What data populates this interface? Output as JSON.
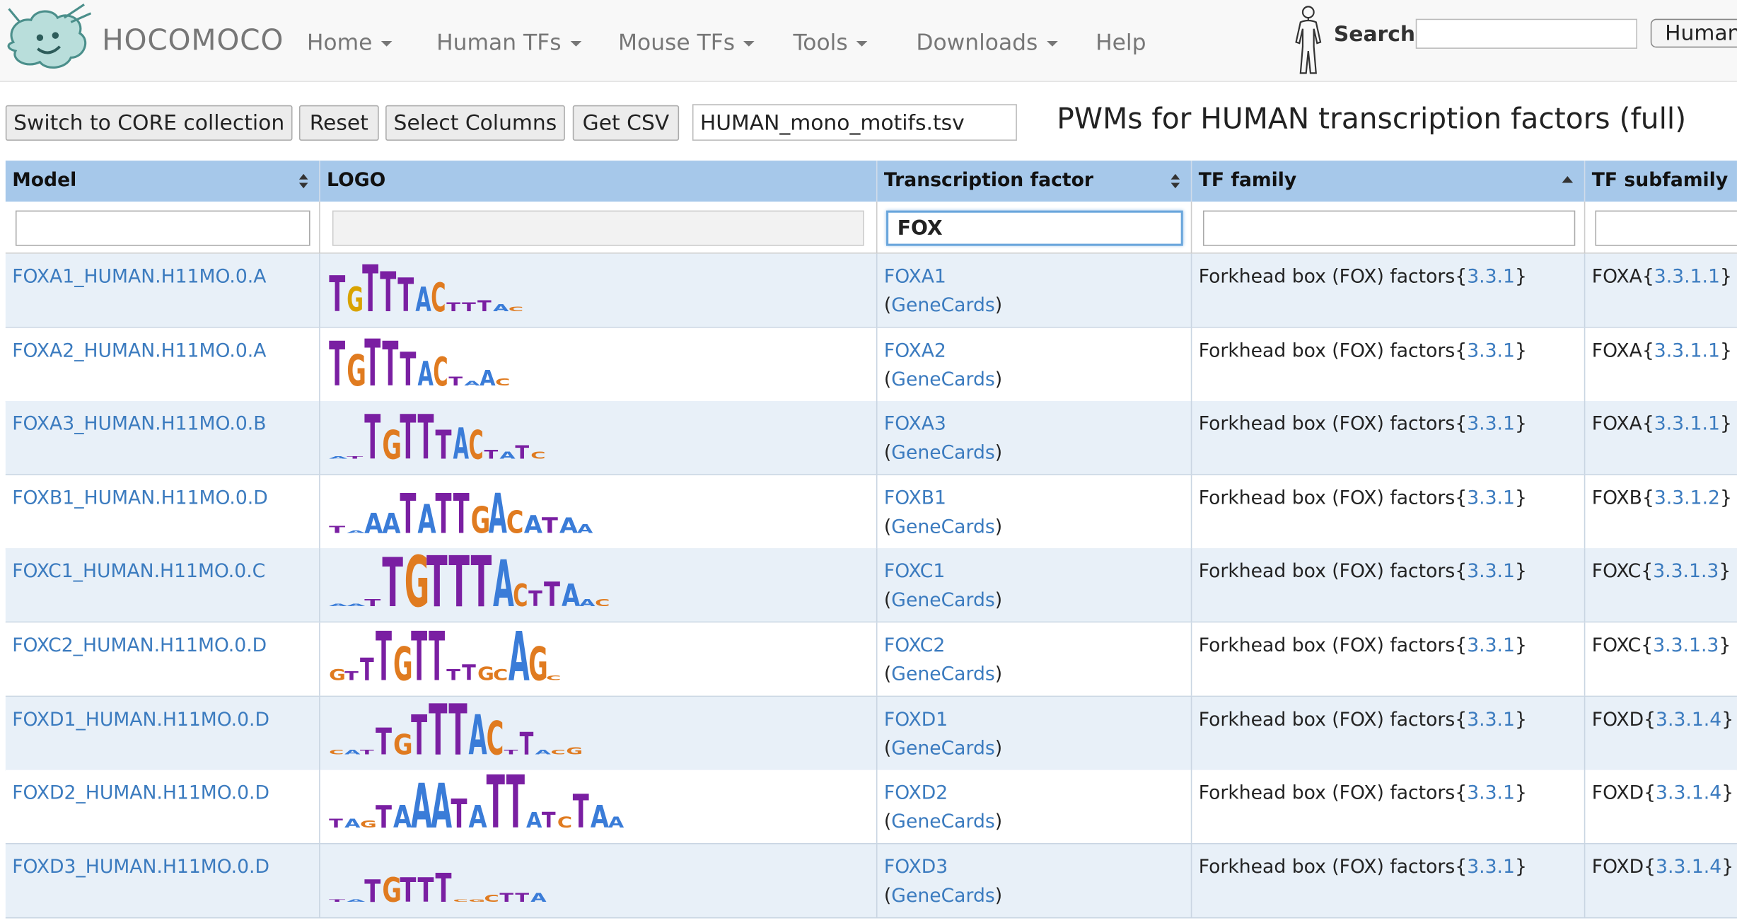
{
  "navbar": {
    "brand": "HOCOMOCO",
    "items": [
      "Home",
      "Human TFs",
      "Mouse TFs",
      "Tools",
      "Downloads",
      "Help"
    ],
    "search_label": "Search:",
    "search_value": "",
    "species_button": "Human"
  },
  "toolbar": {
    "switch_label": "Switch to CORE collection",
    "reset_label": "Reset",
    "select_columns_label": "Select Columns",
    "get_csv_label": "Get CSV",
    "file_name": "HUMAN_mono_motifs.tsv",
    "page_title": "PWMs for HUMAN transcription factors (full)"
  },
  "table": {
    "headers": {
      "model": "Model",
      "logo": "LOGO",
      "tf": "Transcription factor",
      "family": "TF family",
      "subfamily": "TF subfamily"
    },
    "filters": {
      "model": "",
      "logo": "",
      "tf": "FOX",
      "family": "",
      "subfamily": ""
    },
    "genecards_label": "GeneCards",
    "rows": [
      {
        "model": "FOXA1_HUMAN.H11MO.0.A",
        "tf": "FOXA1",
        "family": "Forkhead box (FOX) factors",
        "family_code": "3.3.1",
        "subfamily": "FOXA",
        "subfamily_code": "3.3.1.1",
        "logo": [
          [
            "T",
            32,
            "#7a1fa2",
            14
          ],
          [
            "G",
            22,
            "#d9a300",
            12
          ],
          [
            "T",
            42,
            "#7a1fa2",
            14
          ],
          [
            "T",
            36,
            "#7a1fa2",
            14
          ],
          [
            "T",
            30,
            "#7a1fa2",
            14
          ],
          [
            "A",
            22,
            "#3a7cd8",
            12
          ],
          [
            "C",
            26,
            "#e07b20",
            12
          ],
          [
            "T",
            8,
            "#7a1fa2",
            12
          ],
          [
            "T",
            8,
            "#7a1fa2",
            12
          ],
          [
            "T",
            10,
            "#7a1fa2",
            12
          ],
          [
            "A",
            6,
            "#3a7cd8",
            12
          ],
          [
            "C",
            4,
            "#e07b20",
            12
          ]
        ]
      },
      {
        "model": "FOXA2_HUMAN.H11MO.0.A",
        "tf": "FOXA2",
        "family": "Forkhead box (FOX) factors",
        "family_code": "3.3.1",
        "subfamily": "FOXA",
        "subfamily_code": "3.3.1.1",
        "logo": [
          [
            "T",
            40,
            "#7a1fa2",
            14
          ],
          [
            "G",
            28,
            "#e07b20",
            14
          ],
          [
            "T",
            42,
            "#7a1fa2",
            14
          ],
          [
            "T",
            40,
            "#7a1fa2",
            14
          ],
          [
            "T",
            30,
            "#7a1fa2",
            14
          ],
          [
            "A",
            22,
            "#3a7cd8",
            12
          ],
          [
            "C",
            26,
            "#e07b20",
            12
          ],
          [
            "T",
            8,
            "#7a1fa2",
            12
          ],
          [
            "A",
            4,
            "#3a7cd8",
            12
          ],
          [
            "A",
            14,
            "#3a7cd8",
            12
          ],
          [
            "C",
            6,
            "#e07b20",
            12
          ]
        ]
      },
      {
        "model": "FOXA3_HUMAN.H11MO.0.B",
        "tf": "FOXA3",
        "family": "Forkhead box (FOX) factors",
        "family_code": "3.3.1",
        "subfamily": "FOXA",
        "subfamily_code": "3.3.1.1",
        "logo": [
          [
            "A",
            2,
            "#3a7cd8",
            14
          ],
          [
            "T",
            2,
            "#7a1fa2",
            14
          ],
          [
            "T",
            40,
            "#7a1fa2",
            14
          ],
          [
            "G",
            26,
            "#e07b20",
            14
          ],
          [
            "T",
            40,
            "#7a1fa2",
            14
          ],
          [
            "T",
            40,
            "#7a1fa2",
            14
          ],
          [
            "T",
            26,
            "#7a1fa2",
            14
          ],
          [
            "A",
            28,
            "#3a7cd8",
            12
          ],
          [
            "C",
            26,
            "#e07b20",
            12
          ],
          [
            "T",
            8,
            "#7a1fa2",
            12
          ],
          [
            "A",
            6,
            "#3a7cd8",
            12
          ],
          [
            "T",
            12,
            "#7a1fa2",
            12
          ],
          [
            "C",
            6,
            "#e07b20",
            12
          ]
        ]
      },
      {
        "model": "FOXB1_HUMAN.H11MO.0.D",
        "tf": "FOXB1",
        "family": "Forkhead box (FOX) factors",
        "family_code": "3.3.1",
        "subfamily": "FOXB",
        "subfamily_code": "3.3.1.2",
        "logo": [
          [
            "T",
            6,
            "#7a1fa2",
            14
          ],
          [
            "A",
            2,
            "#3a7cd8",
            14
          ],
          [
            "A",
            18,
            "#3a7cd8",
            14
          ],
          [
            "A",
            18,
            "#3a7cd8",
            14
          ],
          [
            "T",
            36,
            "#7a1fa2",
            14
          ],
          [
            "A",
            26,
            "#3a7cd8",
            14
          ],
          [
            "T",
            36,
            "#7a1fa2",
            14
          ],
          [
            "T",
            36,
            "#7a1fa2",
            14
          ],
          [
            "G",
            24,
            "#e07b20",
            14
          ],
          [
            "A",
            36,
            "#3a7cd8",
            14
          ],
          [
            "C",
            20,
            "#e07b20",
            14
          ],
          [
            "A",
            16,
            "#3a7cd8",
            14
          ],
          [
            "T",
            14,
            "#7a1fa2",
            14
          ],
          [
            "A",
            14,
            "#3a7cd8",
            14
          ],
          [
            "A",
            8,
            "#3a7cd8",
            12
          ]
        ]
      },
      {
        "model": "FOXC1_HUMAN.H11MO.0.C",
        "tf": "FOXC1",
        "family": "Forkhead box (FOX) factors",
        "family_code": "3.3.1",
        "subfamily": "FOXC",
        "subfamily_code": "3.3.1.3",
        "logo": [
          [
            "A",
            2,
            "#3a7cd8",
            14
          ],
          [
            "A",
            2,
            "#3a7cd8",
            14
          ],
          [
            "T",
            6,
            "#7a1fa2",
            14
          ],
          [
            "T",
            44,
            "#7a1fa2",
            18
          ],
          [
            "G",
            46,
            "#e07b20",
            18
          ],
          [
            "T",
            46,
            "#7a1fa2",
            18
          ],
          [
            "T",
            46,
            "#7a1fa2",
            18
          ],
          [
            "T",
            46,
            "#7a1fa2",
            18
          ],
          [
            "A",
            42,
            "#3a7cd8",
            16
          ],
          [
            "C",
            20,
            "#e07b20",
            12
          ],
          [
            "T",
            14,
            "#7a1fa2",
            12
          ],
          [
            "T",
            22,
            "#7a1fa2",
            14
          ],
          [
            "A",
            20,
            "#3a7cd8",
            14
          ],
          [
            "A",
            6,
            "#3a7cd8",
            12
          ],
          [
            "C",
            6,
            "#e07b20",
            12
          ]
        ]
      },
      {
        "model": "FOXC2_HUMAN.H11MO.0.D",
        "tf": "FOXC2",
        "family": "Forkhead box (FOX) factors",
        "family_code": "3.3.1",
        "subfamily": "FOXC",
        "subfamily_code": "3.3.1.3",
        "logo": [
          [
            "G",
            10,
            "#e07b20",
            12
          ],
          [
            "T",
            8,
            "#7a1fa2",
            12
          ],
          [
            "T",
            20,
            "#7a1fa2",
            12
          ],
          [
            "T",
            44,
            "#7a1fa2",
            14
          ],
          [
            "G",
            30,
            "#e07b20",
            14
          ],
          [
            "T",
            44,
            "#7a1fa2",
            14
          ],
          [
            "T",
            44,
            "#7a1fa2",
            14
          ],
          [
            "T",
            10,
            "#7a1fa2",
            12
          ],
          [
            "T",
            14,
            "#7a1fa2",
            12
          ],
          [
            "G",
            12,
            "#e07b20",
            12
          ],
          [
            "C",
            10,
            "#e07b20",
            12
          ],
          [
            "A",
            44,
            "#3a7cd8",
            16
          ],
          [
            "G",
            30,
            "#e07b20",
            14
          ],
          [
            "C",
            4,
            "#e07b20",
            12
          ]
        ]
      },
      {
        "model": "FOXD1_HUMAN.H11MO.0.D",
        "tf": "FOXD1",
        "family": "Forkhead box (FOX) factors",
        "family_code": "3.3.1",
        "subfamily": "FOXD",
        "subfamily_code": "3.3.1.4",
        "logo": [
          [
            "C",
            4,
            "#e07b20",
            12
          ],
          [
            "A",
            4,
            "#3a7cd8",
            12
          ],
          [
            "T",
            4,
            "#7a1fa2",
            12
          ],
          [
            "T",
            24,
            "#7a1fa2",
            14
          ],
          [
            "G",
            18,
            "#e07b20",
            14
          ],
          [
            "T",
            36,
            "#7a1fa2",
            14
          ],
          [
            "T",
            46,
            "#7a1fa2",
            16
          ],
          [
            "T",
            46,
            "#7a1fa2",
            16
          ],
          [
            "A",
            36,
            "#3a7cd8",
            14
          ],
          [
            "C",
            30,
            "#e07b20",
            14
          ],
          [
            "T",
            4,
            "#7a1fa2",
            12
          ],
          [
            "T",
            20,
            "#7a1fa2",
            12
          ],
          [
            "A",
            4,
            "#3a7cd8",
            12
          ],
          [
            "C",
            4,
            "#e07b20",
            12
          ],
          [
            "G",
            6,
            "#e07b20",
            12
          ]
        ]
      },
      {
        "model": "FOXD2_HUMAN.H11MO.0.D",
        "tf": "FOXD2",
        "family": "Forkhead box (FOX) factors",
        "family_code": "3.3.1",
        "subfamily": "FOXD",
        "subfamily_code": "3.3.1.4",
        "logo": [
          [
            "T",
            8,
            "#7a1fa2",
            12
          ],
          [
            "A",
            8,
            "#3a7cd8",
            12
          ],
          [
            "G",
            6,
            "#e07b20",
            12
          ],
          [
            "T",
            20,
            "#7a1fa2",
            14
          ],
          [
            "A",
            20,
            "#3a7cd8",
            14
          ],
          [
            "A",
            40,
            "#3a7cd8",
            16
          ],
          [
            "A",
            40,
            "#3a7cd8",
            16
          ],
          [
            "T",
            26,
            "#7a1fa2",
            14
          ],
          [
            "A",
            20,
            "#3a7cd8",
            14
          ],
          [
            "T",
            48,
            "#7a1fa2",
            16
          ],
          [
            "T",
            48,
            "#7a1fa2",
            16
          ],
          [
            "A",
            14,
            "#3a7cd8",
            12
          ],
          [
            "T",
            14,
            "#7a1fa2",
            12
          ],
          [
            "C",
            10,
            "#e07b20",
            12
          ],
          [
            "T",
            30,
            "#7a1fa2",
            14
          ],
          [
            "A",
            20,
            "#3a7cd8",
            14
          ],
          [
            "A",
            10,
            "#3a7cd8",
            12
          ]
        ]
      },
      {
        "model": "FOXD3_HUMAN.H11MO.0.D",
        "tf": "FOXD3",
        "family": "Forkhead box (FOX) factors",
        "family_code": "3.3.1",
        "subfamily": "FOXD",
        "subfamily_code": "3.3.1.4",
        "logo": [
          [
            "T",
            2,
            "#7a1fa2",
            14
          ],
          [
            "A",
            2,
            "#3a7cd8",
            14
          ],
          [
            "T",
            20,
            "#7a1fa2",
            14
          ],
          [
            "G",
            22,
            "#e07b20",
            14
          ],
          [
            "T",
            22,
            "#7a1fa2",
            14
          ],
          [
            "T",
            22,
            "#7a1fa2",
            14
          ],
          [
            "T",
            26,
            "#7a1fa2",
            14
          ],
          [
            "C",
            2,
            "#e07b20",
            12
          ],
          [
            "G",
            2,
            "#e07b20",
            12
          ],
          [
            "C",
            6,
            "#e07b20",
            12
          ],
          [
            "T",
            8,
            "#7a1fa2",
            12
          ],
          [
            "T",
            8,
            "#7a1fa2",
            12
          ],
          [
            "A",
            8,
            "#3a7cd8",
            12
          ]
        ]
      }
    ]
  }
}
